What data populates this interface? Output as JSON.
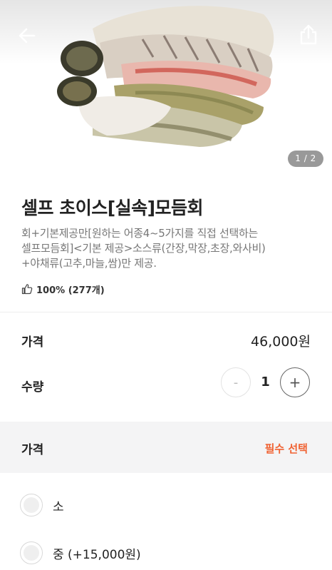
{
  "header": {
    "back_icon": "arrow-left-icon",
    "share_icon": "share-icon",
    "image_counter": "1 / 2"
  },
  "product": {
    "title": "셀프 초이스[실속]모듬회",
    "description": "회+기본제공만[원하는 어종4~5가지를 직접 선택하는\n셀프모듬회]<기본 제공>소스류(간장,막장,초장,와사비)\n+야채류(고추,마늘,쌈)만 제공.",
    "like_icon": "thumbs-up-icon",
    "likes": "100% (277개)"
  },
  "price": {
    "label": "가격",
    "value": "46,000원"
  },
  "quantity": {
    "label": "수량",
    "minus": "-",
    "value": "1",
    "plus": "+"
  },
  "option_group": {
    "label": "가격",
    "required": "필수 선택",
    "options": [
      {
        "label": "소"
      },
      {
        "label": "중 (+15,000원)"
      }
    ]
  },
  "colors": {
    "accent": "#f06232",
    "header_bg": "#f4f4f5"
  }
}
